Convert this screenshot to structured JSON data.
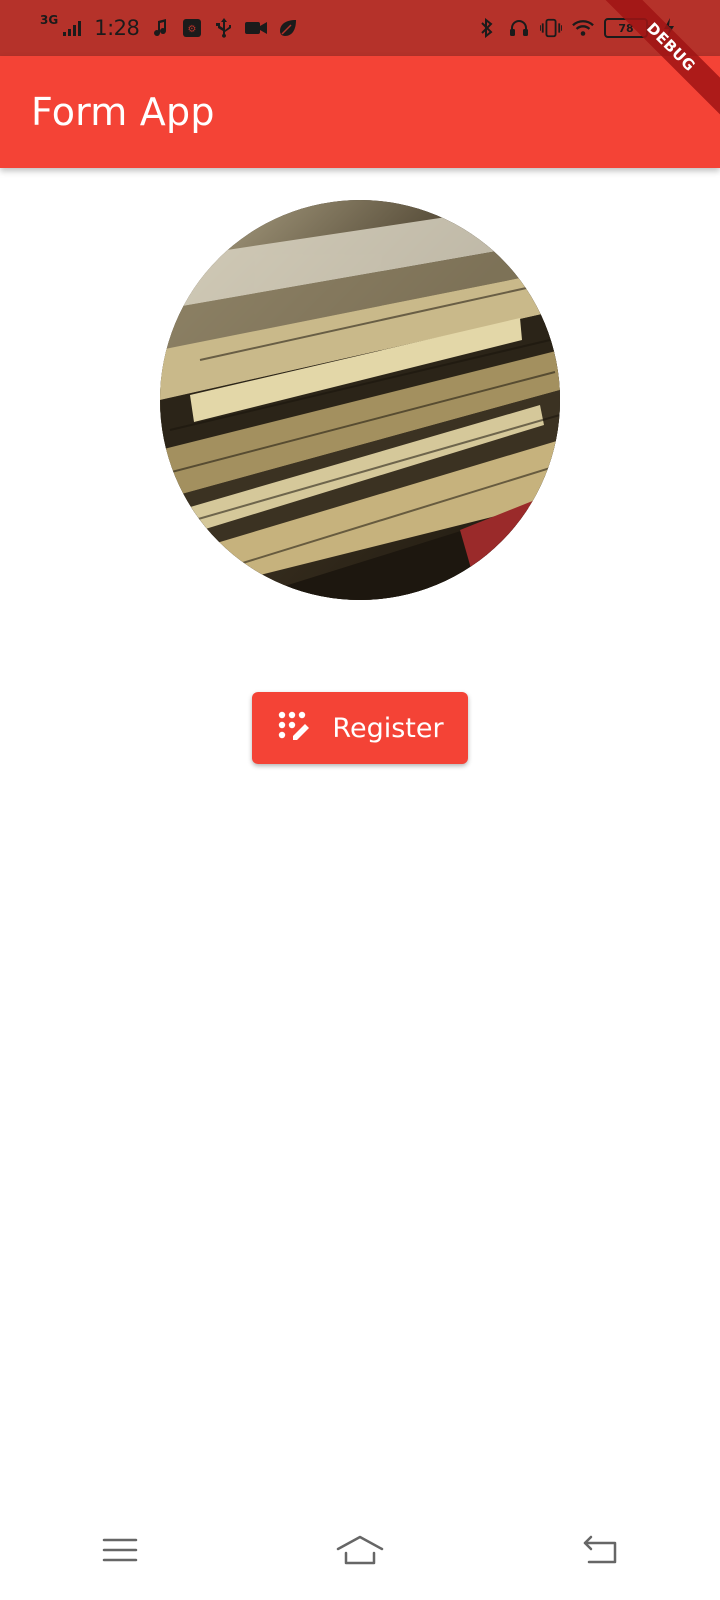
{
  "status_bar": {
    "network": "3G",
    "time": "1:28",
    "battery": "78"
  },
  "debug_banner": "DEBUG",
  "app_bar": {
    "title": "Form App"
  },
  "main": {
    "register_button": {
      "label": "Register",
      "icon": "app-registration-icon"
    }
  },
  "colors": {
    "primary": "#f44336",
    "status_bar": "#b5322a"
  }
}
